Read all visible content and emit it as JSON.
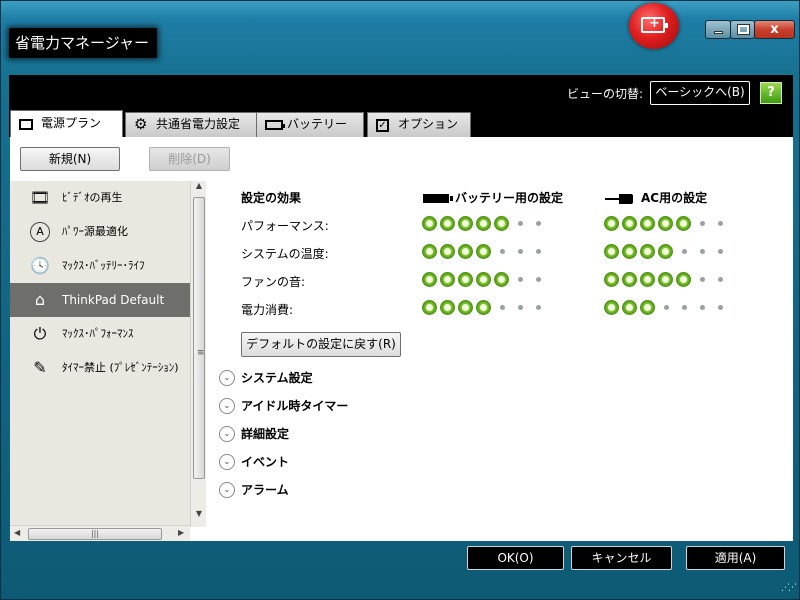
{
  "window": {
    "title": "省電力マネージャー",
    "close_label": "x"
  },
  "view": {
    "label": "ビューの切替:",
    "button_label": "ベーシックへ(B)",
    "help_label": "?"
  },
  "tabs": [
    {
      "label": "電源プラン",
      "active": true,
      "icon": "document-icon"
    },
    {
      "label": "共通省電力設定",
      "active": false,
      "icon": "gear-icon"
    },
    {
      "label": "バッテリー",
      "active": false,
      "icon": "battery-icon"
    },
    {
      "label": "オプション",
      "active": false,
      "icon": "checkbox-icon"
    }
  ],
  "toolbar": {
    "new_label": "新規(N)",
    "delete_label": "削除(D)"
  },
  "plans": [
    {
      "label": "ﾋﾞﾃﾞｵの再生",
      "icon": "film-icon",
      "selected": false
    },
    {
      "label": "ﾊﾟﾜｰ源最適化",
      "icon": "auto-icon",
      "selected": false
    },
    {
      "label": "ﾏｯｸｽ･ﾊﾞｯﾃﾘｰ･ﾗｲﾌ",
      "icon": "battery-clock-icon",
      "selected": false
    },
    {
      "label": "ThinkPad Default",
      "icon": "house-icon",
      "selected": true
    },
    {
      "label": "ﾏｯｸｽ･ﾊﾟﾌｫｰﾏﾝｽ",
      "icon": "power-icon",
      "selected": false
    },
    {
      "label": "ﾀｲﾏｰ禁止 (ﾌﾟﾚｾﾞﾝﾃｰｼｮﾝ)",
      "icon": "presentation-icon",
      "selected": false
    }
  ],
  "settings": {
    "effect_header": "設定の効果",
    "battery_header": "バッテリー用の設定",
    "ac_header": "AC用の設定",
    "rows": [
      {
        "label": "パフォーマンス:",
        "battery_level": 5,
        "ac_level": 5,
        "max": 7
      },
      {
        "label": "システムの温度:",
        "battery_level": 4,
        "ac_level": 4,
        "max": 7
      },
      {
        "label": "ファンの音:",
        "battery_level": 5,
        "ac_level": 5,
        "max": 7
      },
      {
        "label": "電力消費:",
        "battery_level": 4,
        "ac_level": 3,
        "max": 7
      }
    ],
    "reset_label": "デフォルトの設定に戻す(R)"
  },
  "sections": [
    "システム設定",
    "アイドル時タイマー",
    "詳細設定",
    "イベント",
    "アラーム"
  ],
  "footer": {
    "ok_label": "OK(O)",
    "cancel_label": "キャンセル",
    "apply_label": "適用(A)"
  }
}
